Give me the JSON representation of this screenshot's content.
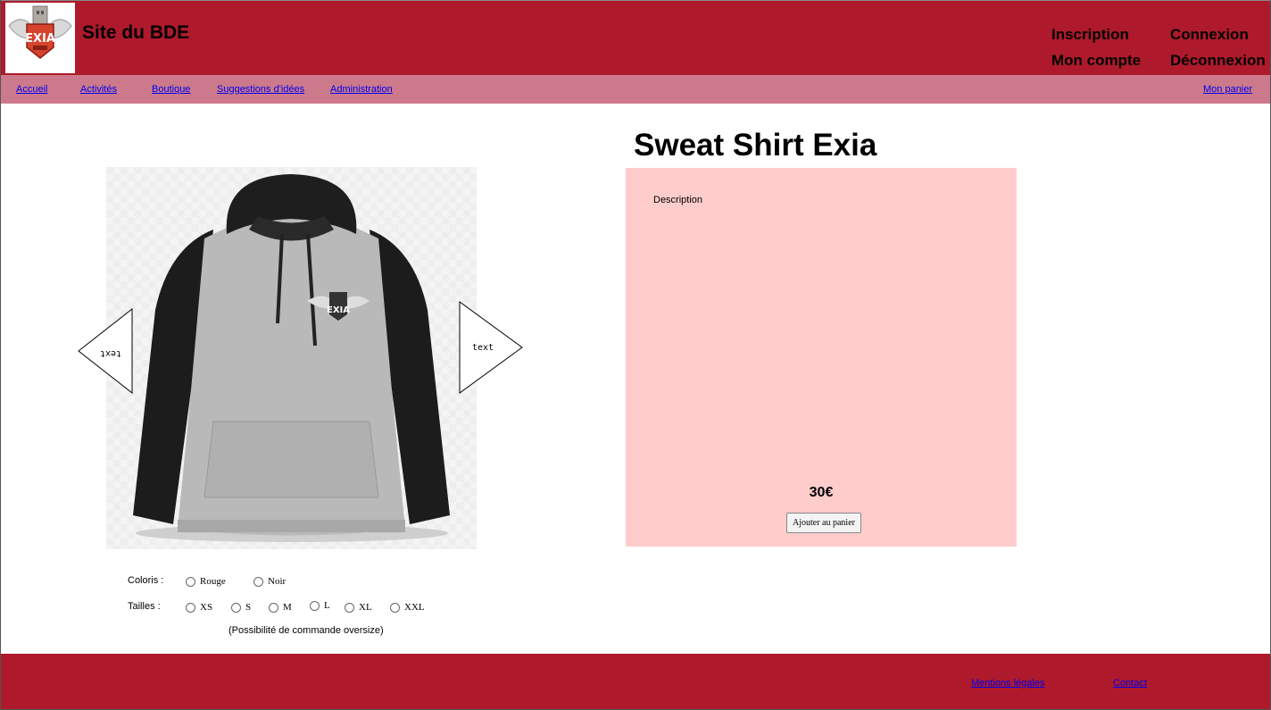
{
  "header": {
    "site_title": "Site du BDE",
    "logo_icon": "exia-logo-icon",
    "account": {
      "inscription": "Inscription",
      "connexion": "Connexion",
      "mon_compte": "Mon compte",
      "deconnexion": "Déconnexion"
    },
    "colors": {
      "header_bg": "#ae1a2b",
      "nav_bg": "#cc7a8b"
    }
  },
  "nav": {
    "items": [
      {
        "label": "Accueil"
      },
      {
        "label": "Activités"
      },
      {
        "label": "Boutique"
      },
      {
        "label": "Suggestions d'idées"
      },
      {
        "label": "Administration"
      }
    ],
    "cart_label": "Mon panier"
  },
  "product": {
    "title": "Sweat Shirt Exia",
    "image_icon": "hoodie-image",
    "arrow_left_text": "text",
    "arrow_right_text": "text",
    "description_label": "Description",
    "price": "30€",
    "add_to_cart_label": "Ajouter au panier",
    "panel_color": "#ffcccc"
  },
  "options": {
    "colors_label": "Coloris :",
    "colors": [
      {
        "label": "Rouge",
        "checked": false
      },
      {
        "label": "Noir",
        "checked": false
      }
    ],
    "sizes_label": "Tailles :",
    "sizes": [
      {
        "label": "XS",
        "checked": false
      },
      {
        "label": "S",
        "checked": false
      },
      {
        "label": "M",
        "checked": false
      },
      {
        "label": "L",
        "checked": false
      },
      {
        "label": "XL",
        "checked": false
      },
      {
        "label": "XXL",
        "checked": false
      }
    ],
    "note": "(Possibilité de commande oversize)"
  },
  "footer": {
    "legal_label": "Mentions légales",
    "contact_label": "Contact"
  }
}
